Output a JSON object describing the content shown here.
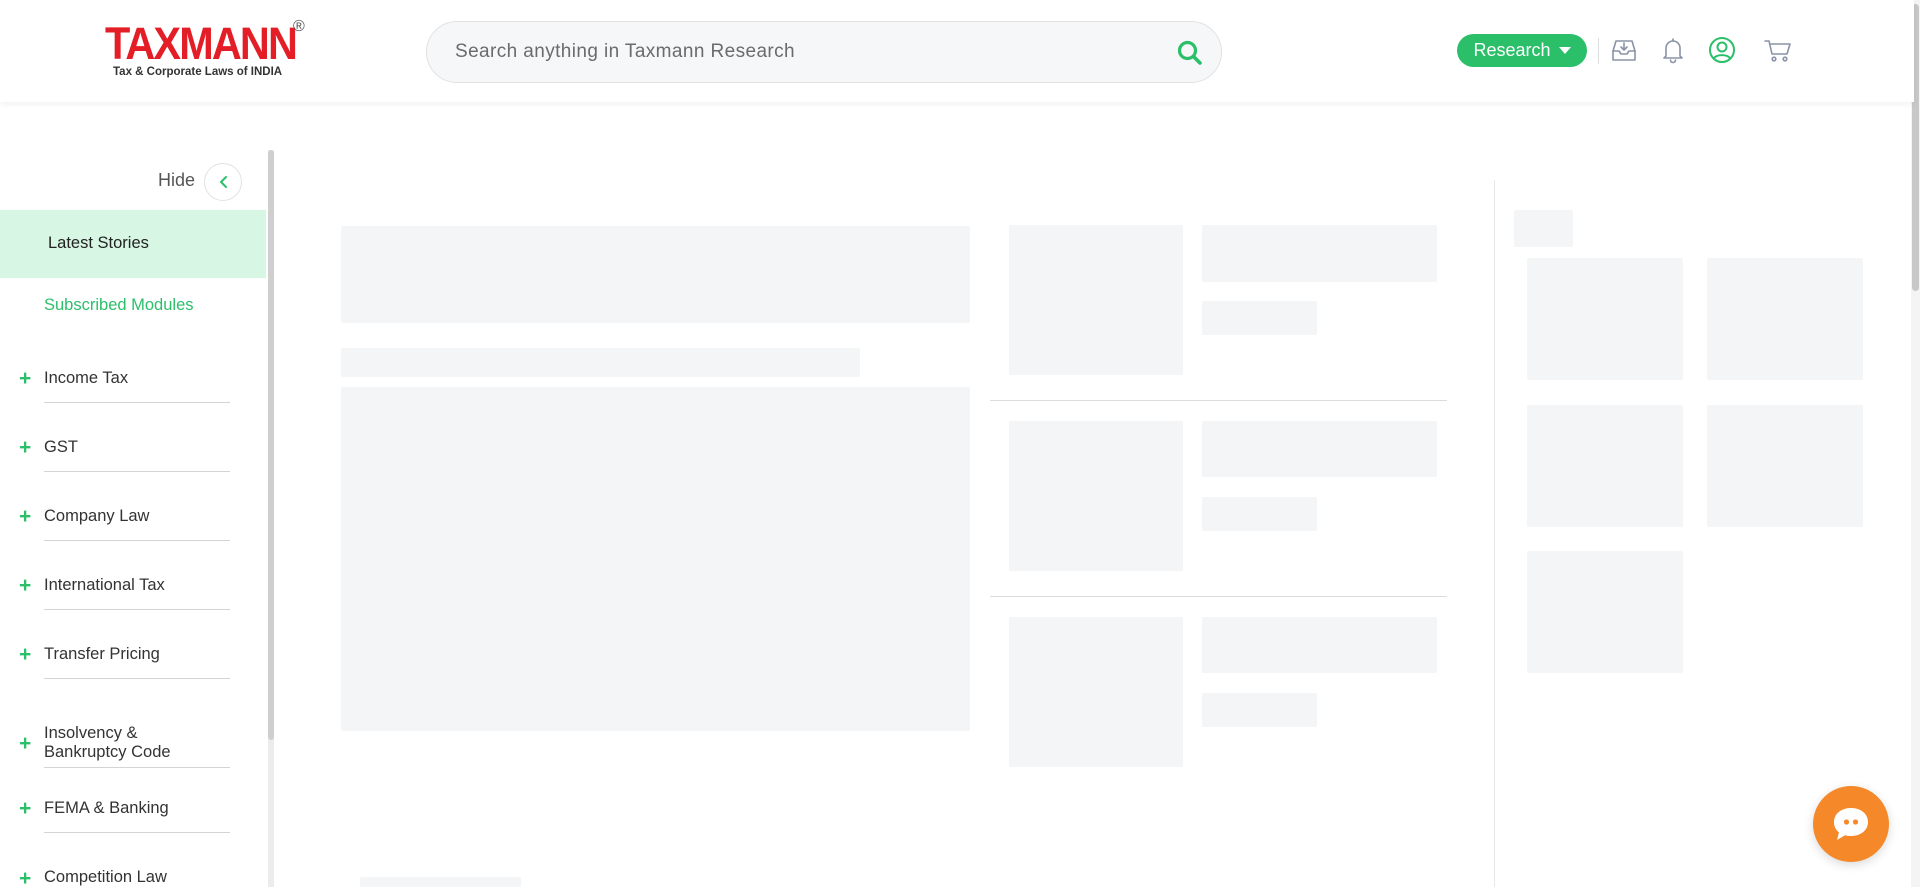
{
  "header": {
    "logo": {
      "brand": "TAXMANN",
      "registered": "®",
      "tagline": "Tax & Corporate Laws of INDIA"
    },
    "search": {
      "placeholder": "Search anything in Taxmann Research",
      "value": ""
    },
    "research_button": "Research",
    "icons": [
      "download-inbox-icon",
      "bell-icon",
      "user-icon",
      "cart-icon"
    ]
  },
  "sidebar": {
    "hide_label": "Hide",
    "latest_stories": "Latest Stories",
    "subscribed_modules": "Subscribed Modules",
    "items": [
      {
        "label": "Income Tax"
      },
      {
        "label": "GST"
      },
      {
        "label": "Company Law"
      },
      {
        "label": "International Tax"
      },
      {
        "label": "Transfer Pricing"
      },
      {
        "label": "Insolvency &\nBankruptcy Code"
      },
      {
        "label": "FEMA & Banking"
      },
      {
        "label": "Competition Law"
      }
    ]
  },
  "colors": {
    "brand_red": "#e41e26",
    "accent_green": "#2bbf6a",
    "active_bg": "#d7f7e4",
    "skeleton": "#f4f5f6",
    "chat_orange": "#f5892a"
  }
}
